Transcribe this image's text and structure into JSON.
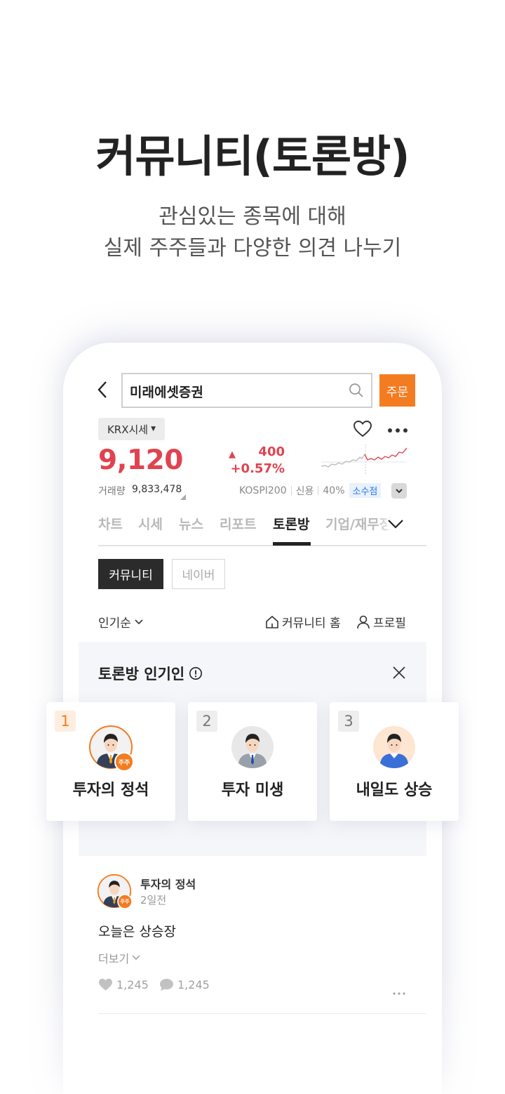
{
  "hero": {
    "title": "커뮤니티(토론방)",
    "subtitle_line1": "관심있는 종목에 대해",
    "subtitle_line2": "실제 주주들과 다양한 의견 나누기"
  },
  "header": {
    "search_value": "미래에셋증권",
    "order_label": "주문"
  },
  "quote": {
    "market_label": "KRX시세",
    "price": "9,120",
    "change_amount": "400",
    "change_percent": "+0.57%",
    "volume_label": "거래량",
    "volume_value": "9,833,478",
    "index_label": "KOSPI200",
    "credit_label": "신용",
    "credit_value": "40%",
    "fraction_label": "소수점",
    "price_color": "#e0434f"
  },
  "tabs": [
    {
      "label": "차트",
      "active": false
    },
    {
      "label": "시세",
      "active": false
    },
    {
      "label": "뉴스",
      "active": false
    },
    {
      "label": "리포트",
      "active": false
    },
    {
      "label": "토론방",
      "active": true
    },
    {
      "label": "기업/재무정",
      "active": false
    }
  ],
  "segments": {
    "community": "커뮤니티",
    "naver": "네이버"
  },
  "toolbar": {
    "sort_label": "인기순",
    "home_label": "커뮤니티 홈",
    "profile_label": "프로필"
  },
  "popular": {
    "title": "토론방 인기인",
    "users": [
      {
        "rank": "1",
        "name": "투자의 정석",
        "badge": "주주",
        "icon": "avatar-shareholder-icon"
      },
      {
        "rank": "2",
        "name": "투자 미생",
        "icon": "avatar-man-tie-icon"
      },
      {
        "rank": "3",
        "name": "내일도 상승",
        "icon": "avatar-man-sweater-icon"
      }
    ]
  },
  "post": {
    "author": "투자의 정석",
    "badge": "주주",
    "time": "2일전",
    "body": "오늘은 상승장",
    "more_label": "더보기",
    "likes": "1,245",
    "comments": "1,245"
  },
  "colors": {
    "accent": "#f47c20",
    "up": "#e0434f",
    "dark": "#2b2b2b"
  }
}
